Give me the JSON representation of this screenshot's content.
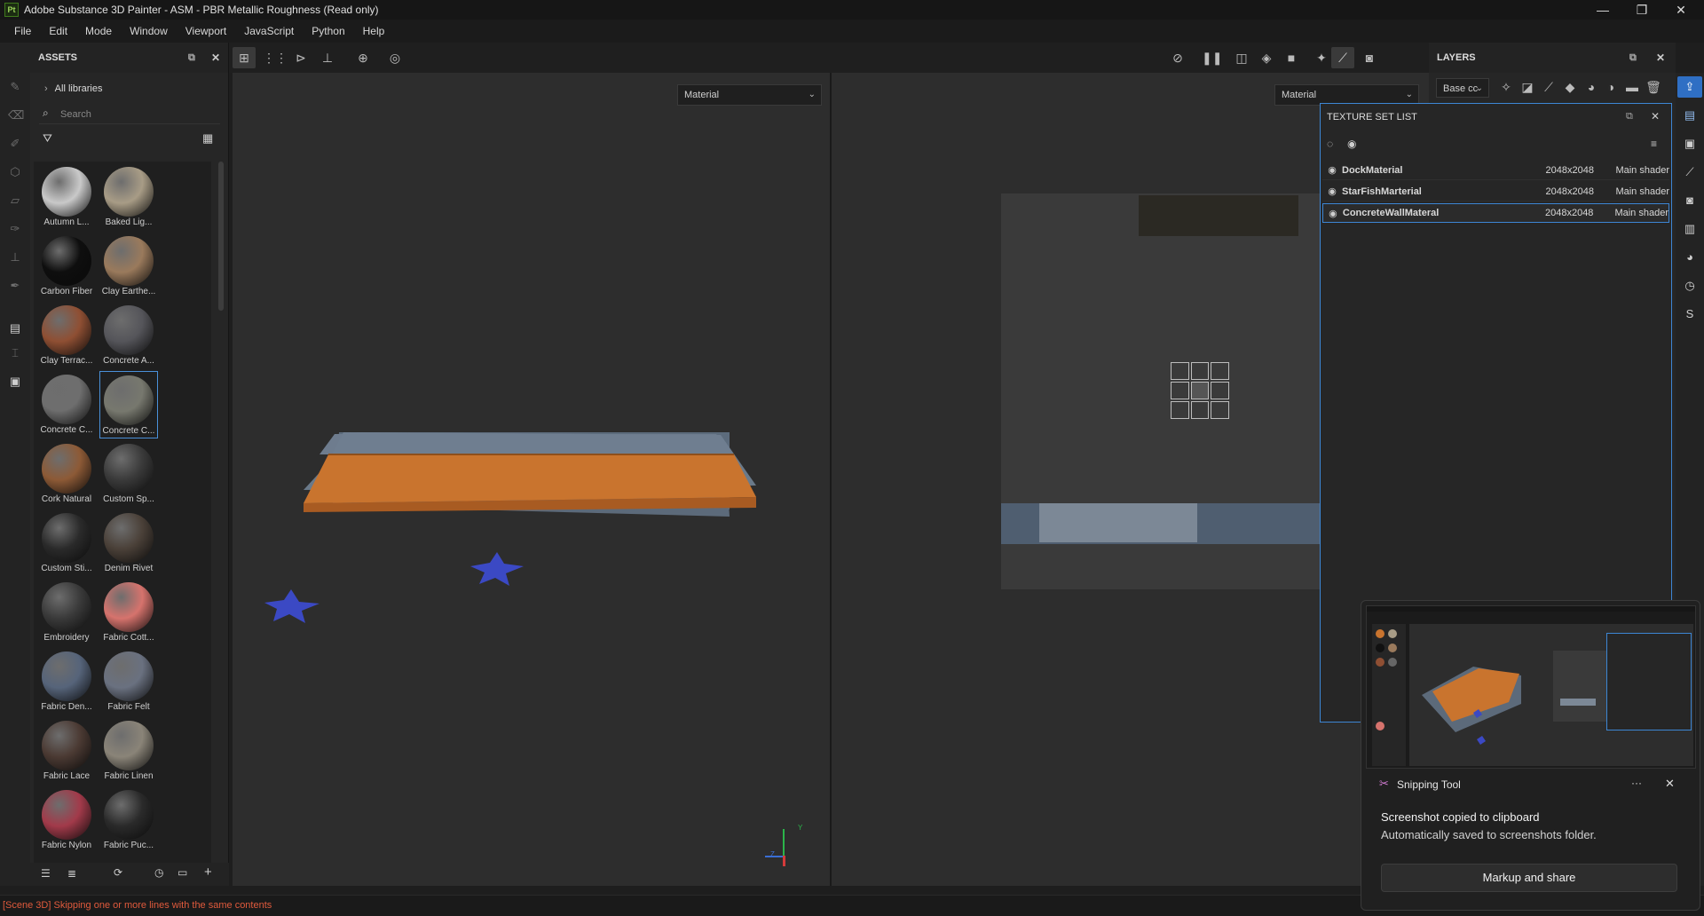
{
  "window": {
    "app_icon_text": "Pt",
    "title": "Adobe Substance 3D Painter - ASM - PBR Metallic Roughness (Read only)",
    "controls": [
      "—",
      "❐",
      "✕"
    ]
  },
  "menu": [
    "File",
    "Edit",
    "Mode",
    "Window",
    "Viewport",
    "JavaScript",
    "Python",
    "Help"
  ],
  "assets": {
    "title": "ASSETS",
    "library": "All libraries",
    "search_placeholder": "Search",
    "items": [
      {
        "label": "Autumn L...",
        "color": "#c9c9c9"
      },
      {
        "label": "Baked Lig...",
        "color": "#a89c86"
      },
      {
        "label": "Carbon Fiber",
        "color": "#0e0e0e"
      },
      {
        "label": "Clay Earthe...",
        "color": "#9a7a5c"
      },
      {
        "label": "Clay Terrac...",
        "color": "#8f4f33"
      },
      {
        "label": "Concrete A...",
        "color": "#55555a"
      },
      {
        "label": "Concrete C...",
        "color": "#6e6e6e"
      },
      {
        "label": "Concrete C...",
        "color": "#77786e"
      },
      {
        "label": "Cork Natural",
        "color": "#8d5a36"
      },
      {
        "label": "Custom Sp...",
        "color": "#3a3a3a"
      },
      {
        "label": "Custom Sti...",
        "color": "#2a2a2a"
      },
      {
        "label": "Denim Rivet",
        "color": "#4a4038"
      },
      {
        "label": "Embroidery",
        "color": "#3a3a3a"
      },
      {
        "label": "Fabric Cott...",
        "color": "#d6736d"
      },
      {
        "label": "Fabric Den...",
        "color": "#56647a"
      },
      {
        "label": "Fabric Felt",
        "color": "#6a7180"
      },
      {
        "label": "Fabric Lace",
        "color": "#4b3a33"
      },
      {
        "label": "Fabric Linen",
        "color": "#8a8478"
      },
      {
        "label": "Fabric Nylon",
        "color": "#a23a4a"
      },
      {
        "label": "Fabric Puc...",
        "color": "#2a2a2a"
      }
    ]
  },
  "viewport": {
    "left_mode": "Material",
    "right_mode": "Material",
    "axis_y": "Y",
    "axis_z": "Z"
  },
  "layers": {
    "title": "LAYERS",
    "channel": "Base cc"
  },
  "texture_set_list": {
    "title": "TEXTURE SET LIST",
    "rows": [
      {
        "name": "DockMaterial",
        "resolution": "2048x2048",
        "shader": "Main shader"
      },
      {
        "name": "StarFishMarterial",
        "resolution": "2048x2048",
        "shader": "Main shader"
      },
      {
        "name": "ConcreteWallMateral",
        "resolution": "2048x2048",
        "shader": "Main shader"
      }
    ]
  },
  "status": {
    "message": "[Scene 3D] Skipping one or more lines with the same contents"
  },
  "snipping_tool": {
    "app_name": "Snipping Tool",
    "more": "···",
    "close": "✕",
    "heading": "Screenshot copied to clipboard",
    "body": "Automatically saved to screenshots folder.",
    "button": "Markup and share"
  },
  "colors": {
    "accent": "#3d86d4",
    "error": "#e05a3c",
    "wood": "#c9742e",
    "concrete": "#5c6a7a",
    "starfish": "#3b49c4"
  }
}
